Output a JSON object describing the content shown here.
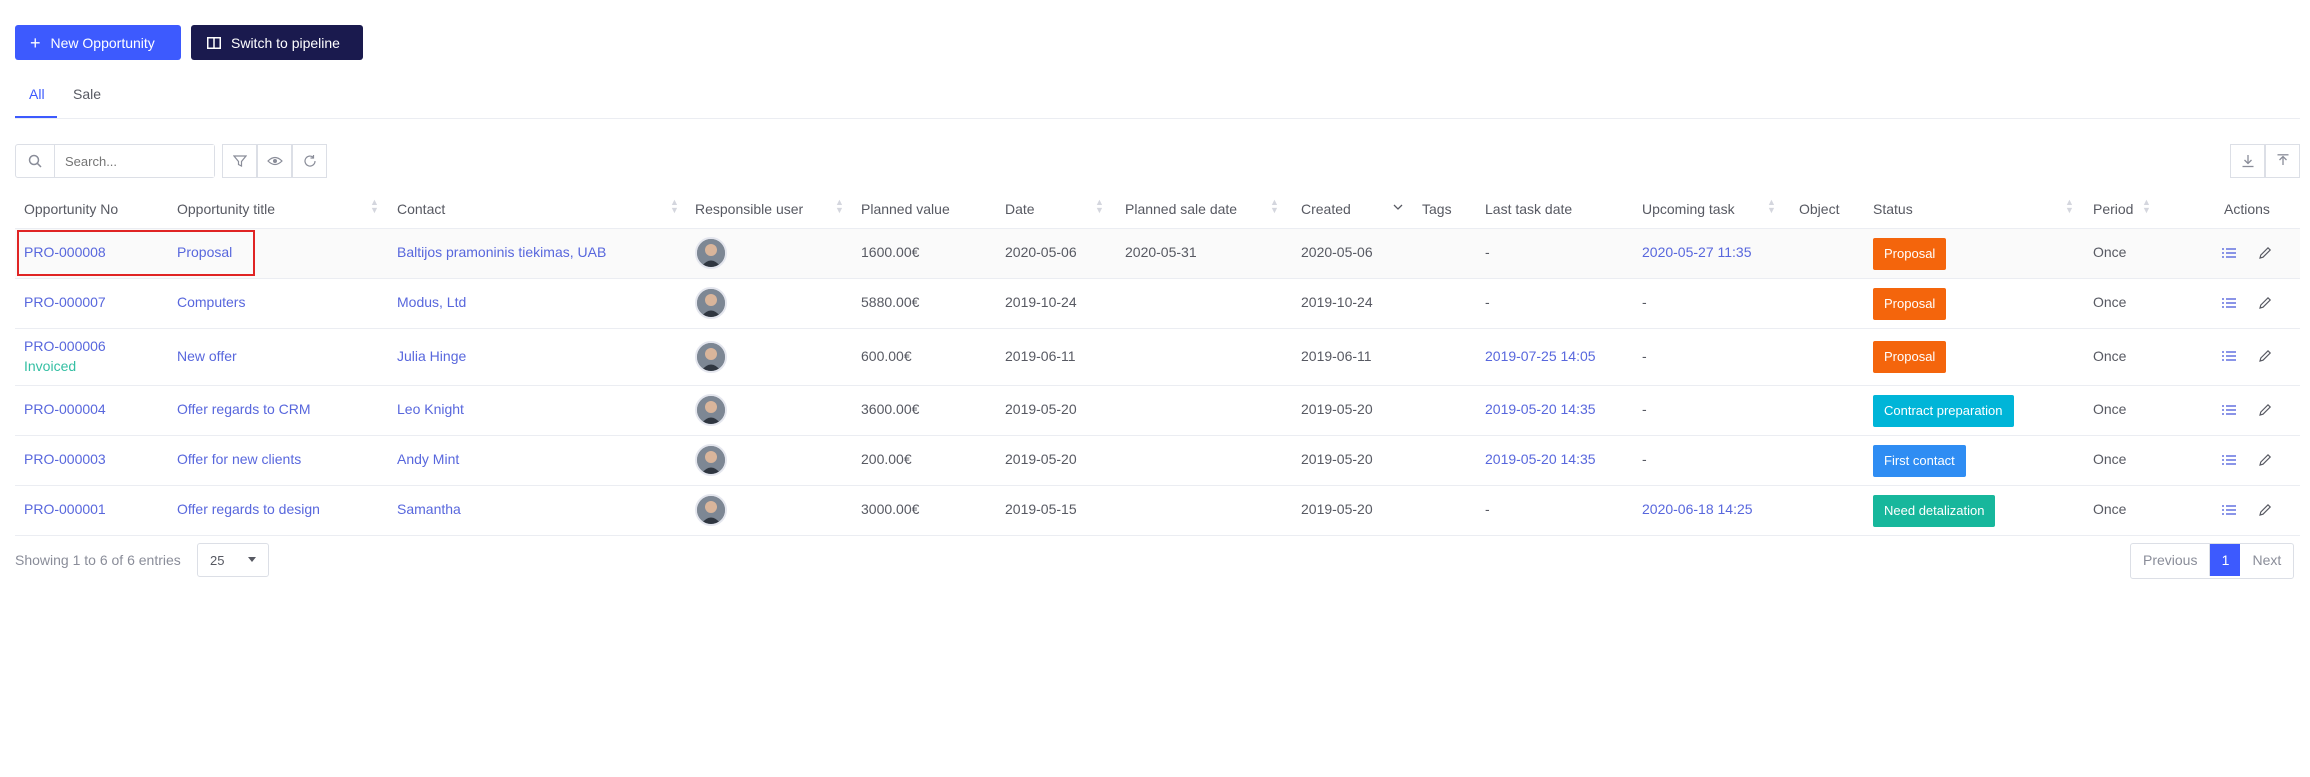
{
  "toolbar": {
    "new_opportunity_label": "New Opportunity",
    "switch_pipeline_label": "Switch to pipeline"
  },
  "tabs": [
    {
      "label": "All",
      "active": true
    },
    {
      "label": "Sale",
      "active": false
    }
  ],
  "search": {
    "placeholder": "Search..."
  },
  "table": {
    "columns": {
      "opportunity_no": "Opportunity No",
      "opportunity_title": "Opportunity title",
      "contact": "Contact",
      "responsible_user": "Responsible user",
      "planned_value": "Planned value",
      "date": "Date",
      "planned_sale_date": "Planned sale date",
      "created": "Created",
      "tags": "Tags",
      "last_task_date": "Last task date",
      "upcoming_task": "Upcoming task",
      "object": "Object",
      "status": "Status",
      "period": "Period",
      "actions": "Actions"
    },
    "rows": [
      {
        "no": "PRO-000008",
        "invoiced": "",
        "title": "Proposal",
        "contact": "Baltijos pramoninis tiekimas, UAB",
        "planned_value": "1600.00€",
        "date": "2020-05-06",
        "planned_sale_date": "2020-05-31",
        "created": "2020-05-06",
        "last_task_date": "-",
        "upcoming_task": "2020-05-27 11:35",
        "status": "Proposal",
        "status_color": "#f4650c",
        "period": "Once"
      },
      {
        "no": "PRO-000007",
        "invoiced": "",
        "title": "Computers",
        "contact": "Modus, Ltd",
        "planned_value": "5880.00€",
        "date": "2019-10-24",
        "planned_sale_date": "",
        "created": "2019-10-24",
        "last_task_date": "-",
        "upcoming_task": "-",
        "status": "Proposal",
        "status_color": "#f4650c",
        "period": "Once"
      },
      {
        "no": "PRO-000006",
        "invoiced": "Invoiced",
        "title": "New offer",
        "contact": "Julia Hinge",
        "planned_value": "600.00€",
        "date": "2019-06-11",
        "planned_sale_date": "",
        "created": "2019-06-11",
        "last_task_date": "2019-07-25 14:05",
        "upcoming_task": "-",
        "status": "Proposal",
        "status_color": "#f4650c",
        "period": "Once"
      },
      {
        "no": "PRO-000004",
        "invoiced": "",
        "title": "Offer regards to CRM",
        "contact": "Leo Knight",
        "planned_value": "3600.00€",
        "date": "2019-05-20",
        "planned_sale_date": "",
        "created": "2019-05-20",
        "last_task_date": "2019-05-20 14:35",
        "upcoming_task": "-",
        "status": "Contract preparation",
        "status_color": "#00b5d8",
        "period": "Once"
      },
      {
        "no": "PRO-000003",
        "invoiced": "",
        "title": "Offer for new clients",
        "contact": "Andy Mint",
        "planned_value": "200.00€",
        "date": "2019-05-20",
        "planned_sale_date": "",
        "created": "2019-05-20",
        "last_task_date": "2019-05-20 14:35",
        "upcoming_task": "-",
        "status": "First contact",
        "status_color": "#2f8df3",
        "period": "Once"
      },
      {
        "no": "PRO-000001",
        "invoiced": "",
        "title": "Offer regards to design",
        "contact": "Samantha",
        "planned_value": "3000.00€",
        "date": "2019-05-15",
        "planned_sale_date": "",
        "created": "2019-05-20",
        "last_task_date": "-",
        "upcoming_task": "2020-06-18 14:25",
        "status": "Need detalization",
        "status_color": "#17b79c",
        "period": "Once"
      }
    ]
  },
  "footer": {
    "showing_text": "Showing 1 to 6 of 6 entries",
    "page_size": "25",
    "previous_label": "Previous",
    "current_page": "1",
    "next_label": "Next"
  },
  "colors": {
    "primary": "#3d5afe",
    "dark_button": "#1a1a4e",
    "link": "#5867dd",
    "highlight": "#e02424"
  }
}
